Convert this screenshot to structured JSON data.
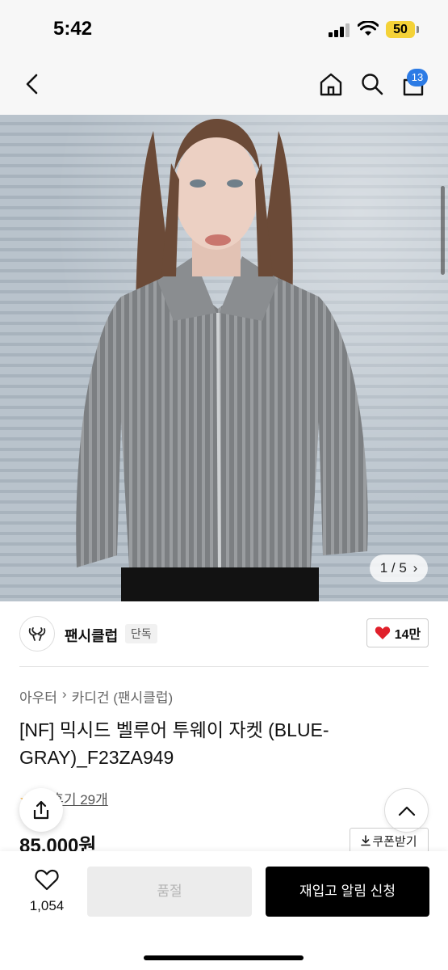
{
  "status_bar": {
    "time": "5:42",
    "battery": "50"
  },
  "nav": {
    "cart_count": "13"
  },
  "gallery": {
    "counter": "1 / 5"
  },
  "brand": {
    "name": "팬시클럽",
    "tag": "단독",
    "likes": "14만"
  },
  "breadcrumb": [
    "아우터",
    "카디건 (팬시클럽)"
  ],
  "product": {
    "title": "[NF] 믹시드 벨루어 투웨이 자켓 (BLUE-GRAY)_F23ZA949",
    "review_label": "후기 29개",
    "price": "85,000원",
    "coupon_label": "쿠폰받기"
  },
  "bottom": {
    "wish_count": "1,054",
    "soldout_label": "품절",
    "restock_label": "재입고 알림 신청"
  },
  "colors": {
    "like_red": "#e0202b",
    "badge_blue": "#2c7be5",
    "primary_black": "#000000"
  },
  "icons": [
    "back-arrow-icon",
    "home-icon",
    "search-icon",
    "cart-icon",
    "heart-icon",
    "share-icon",
    "chevron-up-icon",
    "download-icon",
    "chevron-right-icon"
  ]
}
